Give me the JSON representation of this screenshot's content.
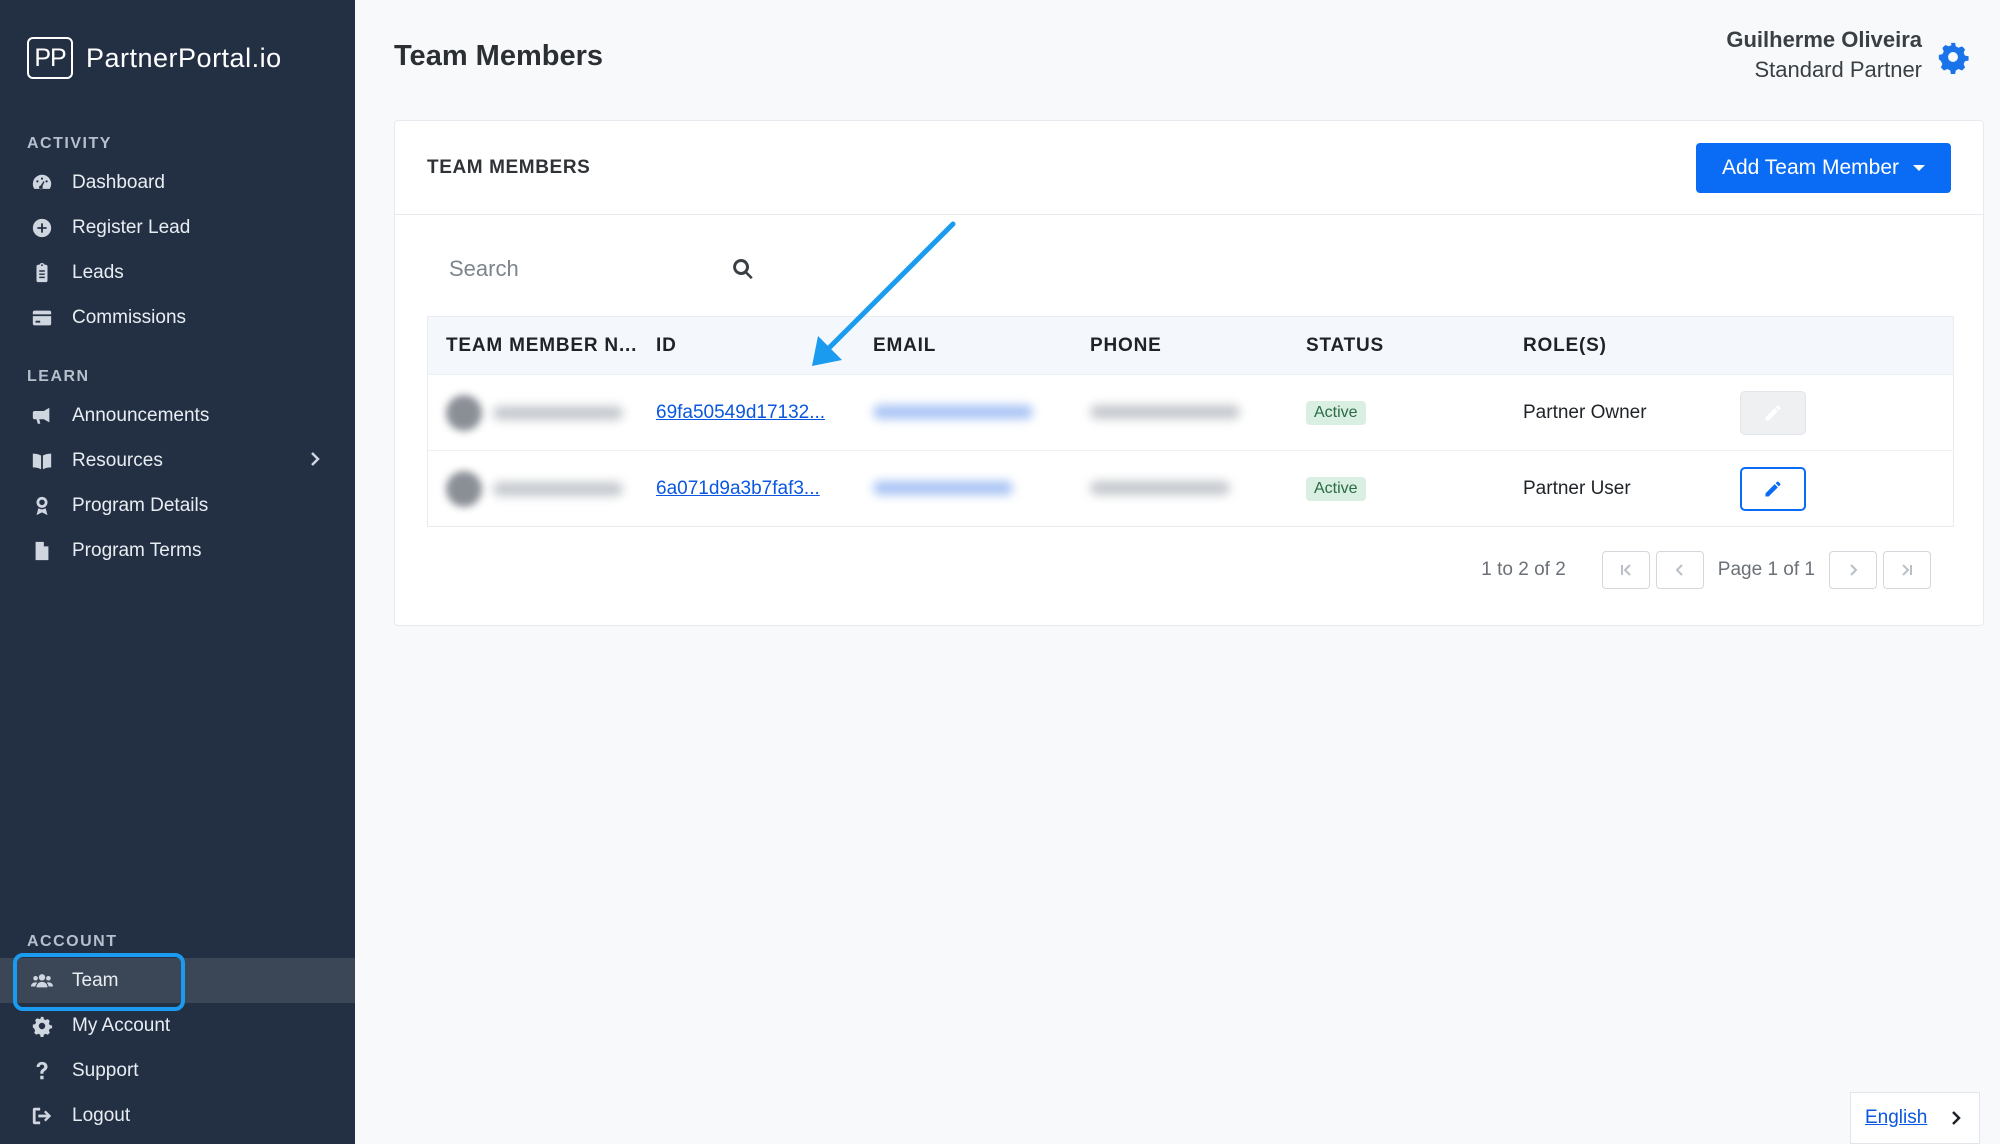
{
  "app": {
    "logo_mark": "PP",
    "logo_text": "PartnerPortal.io"
  },
  "sidebar": {
    "sections": {
      "activity": "ACTIVITY",
      "learn": "LEARN",
      "account": "ACCOUNT"
    },
    "activity_items": [
      {
        "label": "Dashboard",
        "icon": "dashboard-icon"
      },
      {
        "label": "Register Lead",
        "icon": "plus-circle-icon"
      },
      {
        "label": "Leads",
        "icon": "clipboard-icon"
      },
      {
        "label": "Commissions",
        "icon": "credit-card-icon"
      }
    ],
    "learn_items": [
      {
        "label": "Announcements",
        "icon": "megaphone-icon"
      },
      {
        "label": "Resources",
        "icon": "book-icon"
      },
      {
        "label": "Program Details",
        "icon": "award-icon"
      },
      {
        "label": "Program Terms",
        "icon": "file-icon"
      }
    ],
    "account_items": [
      {
        "label": "Team",
        "icon": "users-icon",
        "active": true
      },
      {
        "label": "My Account",
        "icon": "gear-icon"
      },
      {
        "label": "Support",
        "icon": "question-icon"
      },
      {
        "label": "Logout",
        "icon": "logout-icon"
      }
    ]
  },
  "header": {
    "title": "Team Members",
    "user_name": "Guilherme Oliveira",
    "user_role": "Standard Partner"
  },
  "card": {
    "title": "TEAM MEMBERS",
    "add_button": "Add Team Member",
    "search_placeholder": "Search"
  },
  "table": {
    "columns": [
      "TEAM MEMBER N...",
      "ID",
      "EMAIL",
      "PHONE",
      "STATUS",
      "ROLE(S)"
    ],
    "rows": [
      {
        "id": "69fa50549d17132...",
        "status": "Active",
        "role": "Partner Owner",
        "edit_enabled": false
      },
      {
        "id": "6a071d9a3b7faf3...",
        "status": "Active",
        "role": "Partner User",
        "edit_enabled": true
      }
    ]
  },
  "pagination": {
    "count_text": "1 to 2 of 2",
    "page_text": "Page 1 of 1"
  },
  "language": {
    "label": "English"
  },
  "colors": {
    "sidebar_bg": "#233044",
    "accent": "#0a6cf5",
    "annotation": "#1a9bf0"
  }
}
